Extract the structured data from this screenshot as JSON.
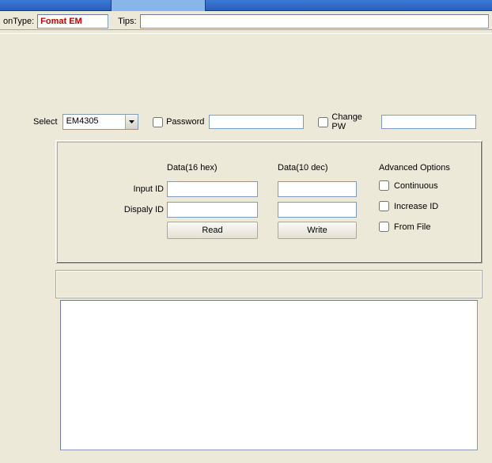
{
  "topbar": {
    "type_label": "onType:",
    "type_value": "Fomat EM",
    "tips_label": "Tips:",
    "tips_value": ""
  },
  "row1": {
    "select_label": "Select",
    "select_value": "EM4305",
    "password_label": "Password",
    "password_value": "",
    "changepw_label": "Change PW",
    "changepw_value": ""
  },
  "group": {
    "col_hex": "Data(16 hex)",
    "col_dec": "Data(10 dec)",
    "col_adv": "Advanced Options",
    "input_id_label": "Input ID",
    "display_id_label": "Dispaly ID",
    "input_id_hex": "",
    "input_id_dec": "",
    "display_id_hex": "",
    "display_id_dec": "",
    "read_btn": "Read",
    "write_btn": "Write",
    "adv_continuous": "Continuous",
    "adv_increase": "Increase ID",
    "adv_fromfile": "From File"
  },
  "log": {
    "content": ""
  }
}
